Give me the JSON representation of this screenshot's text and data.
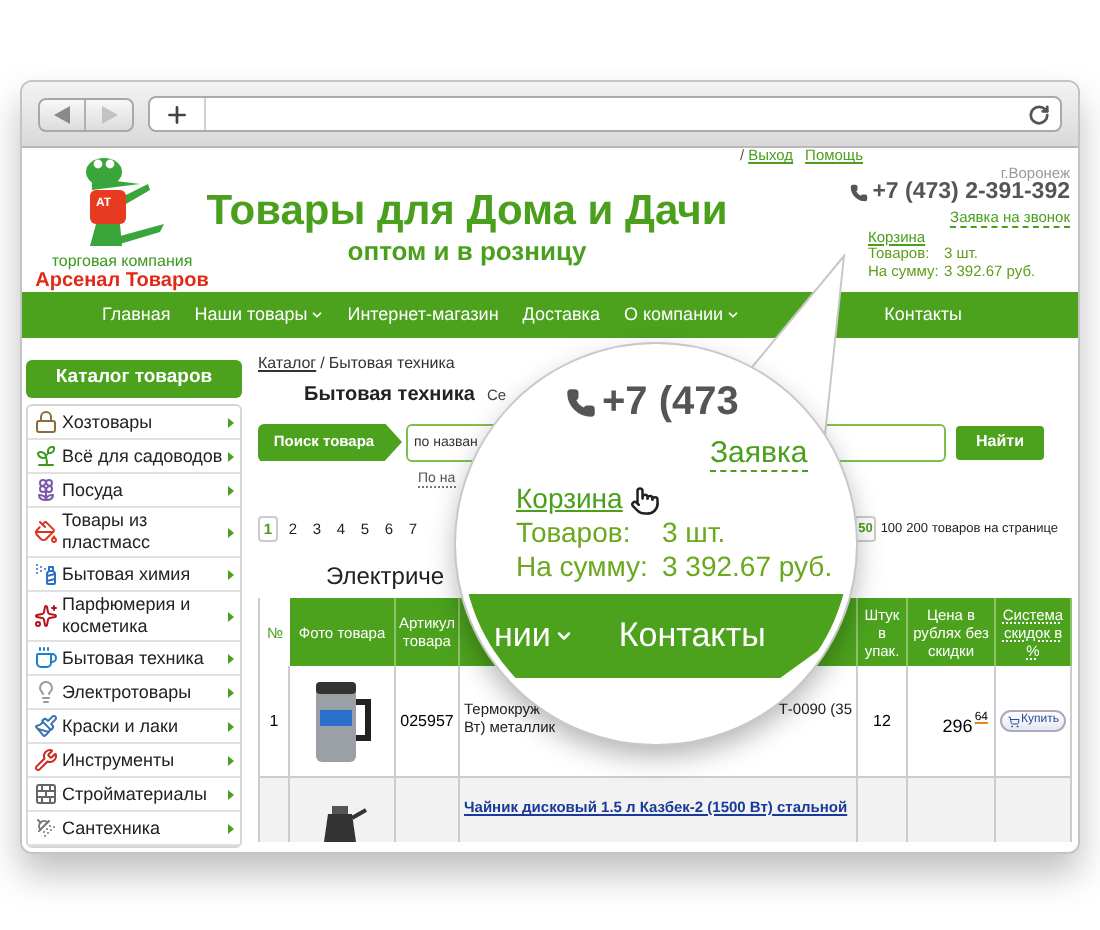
{
  "header": {
    "logo": {
      "badge": "AT",
      "tagline": "торговая компания",
      "name": "Арсенал Товаров"
    },
    "title": "Товары для Дома и Дачи",
    "subtitle": "оптом и в розницу",
    "separator": "/",
    "links": [
      "Выход",
      "Помощь"
    ],
    "city": "г.Воронеж",
    "phone": "+7 (473) 2-391-392",
    "callback": "Заявка на звонок",
    "cart": {
      "title": "Корзина",
      "rows": [
        {
          "label": "Товаров:",
          "value": "3 шт."
        },
        {
          "label": "На сумму:",
          "value": "3 392.67 руб."
        }
      ]
    }
  },
  "nav": [
    {
      "label": "Главная",
      "dropdown": false
    },
    {
      "label": "Наши товары",
      "dropdown": true
    },
    {
      "label": "Интернет-магазин",
      "dropdown": false
    },
    {
      "label": "Доставка",
      "dropdown": false
    },
    {
      "label": "О компании",
      "dropdown": true
    },
    {
      "label": "Контакты",
      "dropdown": false
    }
  ],
  "sidebar": {
    "title": "Каталог товаров",
    "items": [
      "Хозтовары",
      "Всё для садоводов",
      "Посуда",
      "Товары из пластмасс",
      "Бытовая химия",
      "Парфюмерия и косметика",
      "Бытовая техника",
      "Электротовары",
      "Краски и лаки",
      "Инструменты",
      "Стройматериалы",
      "Сантехника"
    ]
  },
  "main": {
    "breadcrumb": {
      "link": "Каталог",
      "separator": "/",
      "current": "Бытовая техника"
    },
    "heading": "Бытовая техника",
    "tab_fragment": "Се",
    "search": {
      "button": "Поиск товара",
      "placeholder": "по назван",
      "submit": "Найти"
    },
    "search_option": "По на",
    "pages": [
      {
        "label": "1",
        "selected": true
      },
      {
        "label": "2",
        "selected": false
      },
      {
        "label": "3",
        "selected": false
      },
      {
        "label": "4",
        "selected": false
      },
      {
        "label": "5",
        "selected": false
      },
      {
        "label": "6",
        "selected": false
      },
      {
        "label": "7",
        "selected": false
      }
    ],
    "per_page": [
      {
        "label": "50",
        "selected": true
      },
      {
        "label": "100",
        "selected": false
      },
      {
        "label": "200",
        "selected": false
      }
    ],
    "per_page_label": "товаров на странице",
    "section_title": "Электриче",
    "table": {
      "columns": [
        "№",
        "Фото товара",
        "Артикул товара",
        "Штук в упак.",
        "Цена в рублях без скидки",
        "Система скидок в %"
      ],
      "rows": [
        {
          "number": "1",
          "article": "025957",
          "name_start": "Термокруж",
          "name_end": "Т-0090 (35",
          "name_line2": "Вт) металлик",
          "pack": "12",
          "price": "296",
          "kopecks": "64",
          "buy": "Купить"
        },
        {
          "name": "Чайник дисковый 1.5 л Казбек-2 (1500 Вт) стальной"
        }
      ]
    }
  },
  "magnifier": {
    "phone": "+7 (473",
    "callback": "Заявка",
    "cart_title": "Корзина",
    "rows": [
      {
        "label": "Товаров:",
        "value": "3 шт."
      },
      {
        "label": "На сумму:",
        "value": "3 392.67 руб."
      }
    ],
    "nav": [
      {
        "label": "нии",
        "dropdown": true
      },
      {
        "label": "Контакты",
        "dropdown": false
      }
    ]
  }
}
